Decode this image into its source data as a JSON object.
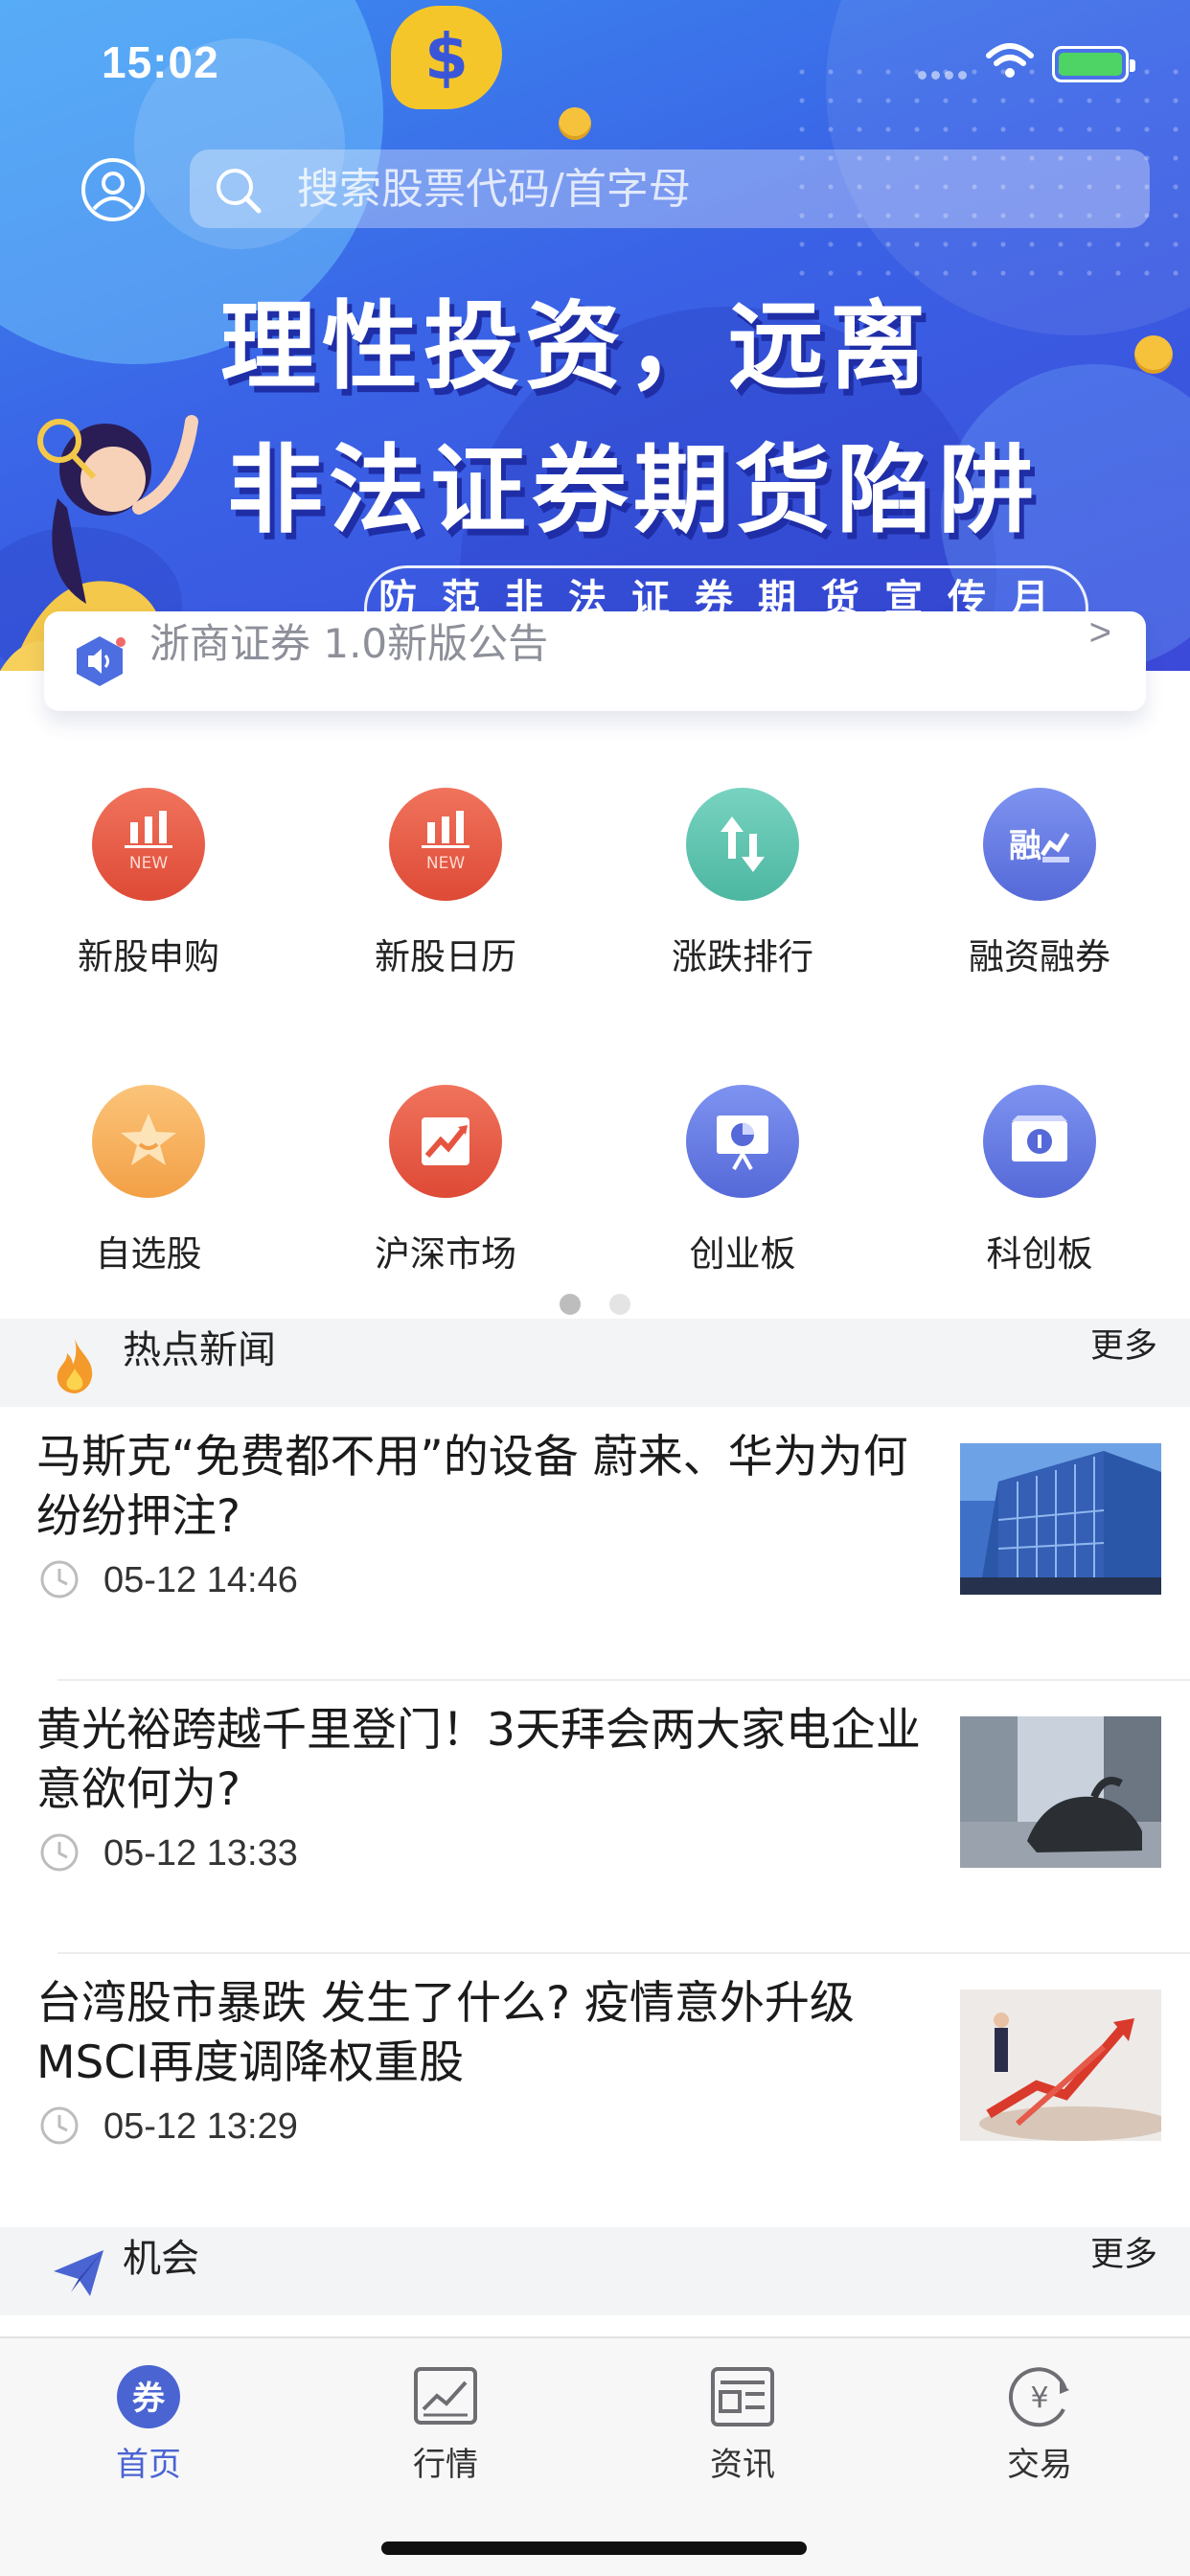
{
  "status_bar": {
    "time": "15:02"
  },
  "search": {
    "placeholder": "搜索股票代码/首字母"
  },
  "banner": {
    "headline_line1": "理性投资，远离",
    "headline_line2": "非法证券期货陷阱",
    "subtitle": "防范非法证券期货宣传月"
  },
  "notice": {
    "text": "浙商证券 1.0新版公告",
    "arrow": ">"
  },
  "menu": {
    "items": [
      {
        "label": "新股申购",
        "icon": "new-stock-icon"
      },
      {
        "label": "新股日历",
        "icon": "new-stock-calendar-icon"
      },
      {
        "label": "涨跌排行",
        "icon": "up-down-arrows-icon"
      },
      {
        "label": "融资融券",
        "icon": "margin-trading-icon"
      },
      {
        "label": "自选股",
        "icon": "star-icon"
      },
      {
        "label": "沪深市场",
        "icon": "trend-chart-icon"
      },
      {
        "label": "创业板",
        "icon": "presentation-board-icon"
      },
      {
        "label": "科创板",
        "icon": "science-board-icon"
      }
    ],
    "page_indicator": {
      "pages": 2,
      "current": 1
    }
  },
  "hot_news": {
    "title": "热点新闻",
    "more": "更多",
    "items": [
      {
        "title": "马斯克“免费都不用”的设备 蔚来、华为为何纷纷押注?",
        "time": "05-12 14:46"
      },
      {
        "title": "黄光裕跨越千里登门！3天拜会两大家电企业 意欲何为?",
        "time": "05-12 13:33"
      },
      {
        "title": "台湾股市暴跌 发生了什么? 疫情意外升级 MSCI再度调降权重股",
        "time": "05-12 13:29"
      }
    ]
  },
  "opportunity": {
    "title": "机会",
    "more": "更多"
  },
  "tabbar": {
    "tabs": [
      {
        "label": "首页",
        "icon": "voucher-icon",
        "active": true
      },
      {
        "label": "行情",
        "icon": "market-chart-icon",
        "active": false
      },
      {
        "label": "资讯",
        "icon": "news-icon",
        "active": false
      },
      {
        "label": "交易",
        "icon": "yuan-icon",
        "active": false
      }
    ]
  },
  "colors": {
    "accent": "#4a64d2",
    "banner": "#3a63e6",
    "red": "#e5543f",
    "teal": "#5cc2ac",
    "orange": "#f6b05c"
  }
}
